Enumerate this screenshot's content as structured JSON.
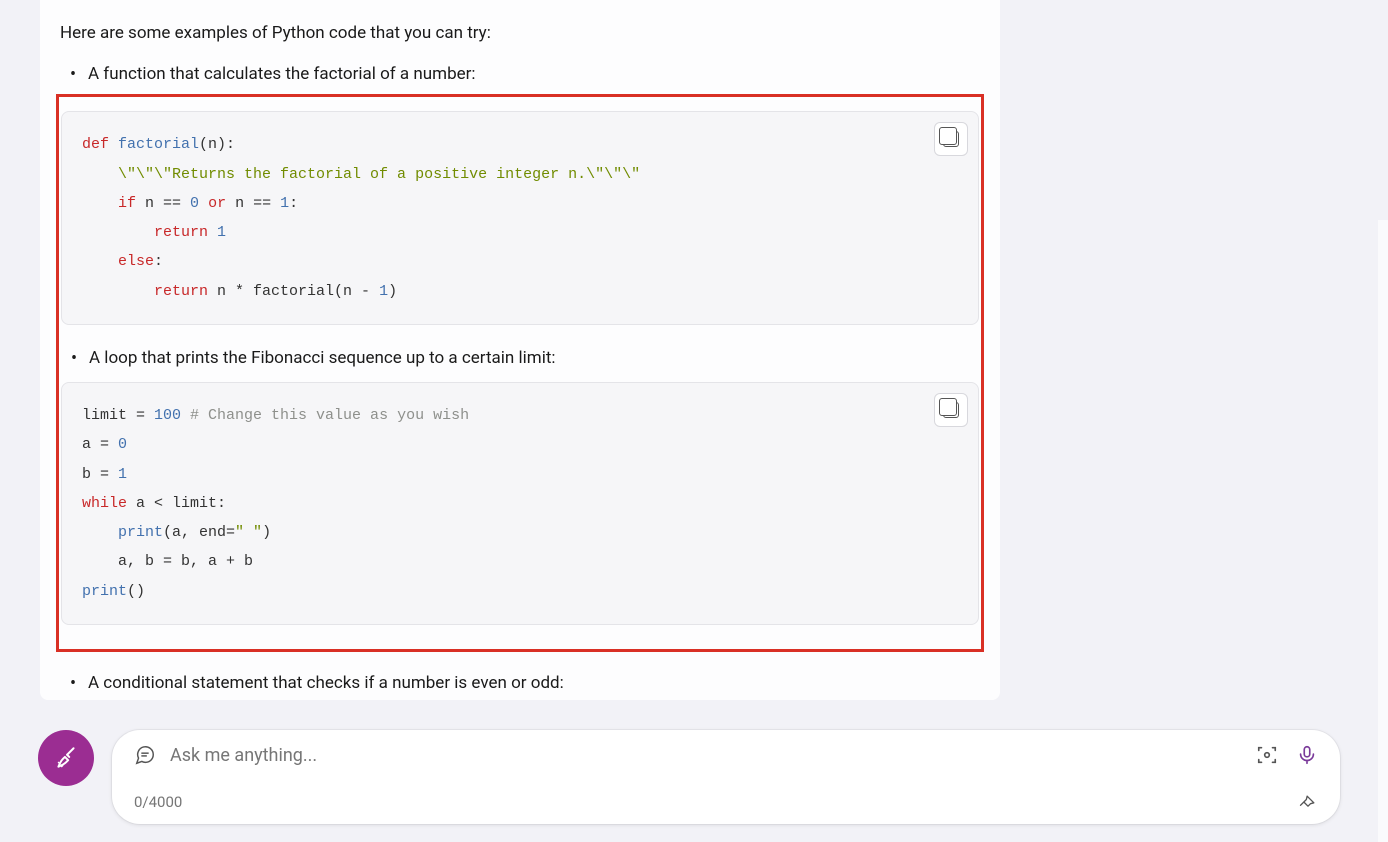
{
  "message": {
    "intro": "Here are some examples of Python code that you can try:",
    "bullet1": "A function that calculates the factorial of a number:",
    "bullet2": "A loop that prints the Fibonacci sequence up to a certain limit:",
    "bullet3": "A conditional statement that checks if a number is even or odd:"
  },
  "code1": {
    "tokens": {
      "def": "def",
      "fname": "factorial",
      "params": "(n):",
      "docstring": "\\\"\\\"\\\"Returns the factorial of a positive integer n.\\\"\\\"\\\"",
      "if": "if",
      "cond": " n == ",
      "zero": "0",
      "orkw": " or ",
      "cond2": "n == ",
      "one": "1",
      "colon": ":",
      "return1": "return",
      "retval1": " 1",
      "else": "else",
      "return2": "return",
      "retexpr": " n * factorial(n - ",
      "one2": "1",
      "rparen": ")"
    }
  },
  "code2": {
    "tokens": {
      "limit": "limit = ",
      "hundred": "100",
      "comment": " # Change this value as you wish",
      "a0": "a = ",
      "zero": "0",
      "b1": "b = ",
      "one": "1",
      "while": "while",
      "cond": " a < limit:",
      "print1": "print",
      "args1": "(a, end=",
      "space_str": "\" \"",
      "rparen1": ")",
      "assign": "    a, b = b, a + b",
      "print2": "print",
      "empty": "()"
    }
  },
  "input": {
    "placeholder": "Ask me anything...",
    "counter": "0/4000"
  },
  "icons": {
    "broom": "broom-icon",
    "chat": "chat-icon",
    "scan": "scan-icon",
    "mic": "mic-icon",
    "pin": "pin-icon",
    "copy": "copy-icon"
  }
}
